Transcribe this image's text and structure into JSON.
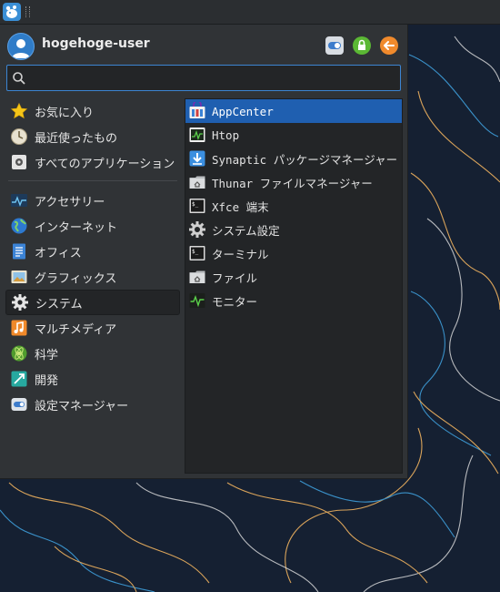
{
  "panel": {
    "menu_button_icon": "xfce-mouse-icon"
  },
  "header": {
    "username": "hogehoge-user",
    "buttons": [
      {
        "icon": "settings-toggle-icon",
        "color": "#5a86c0"
      },
      {
        "icon": "lock-icon",
        "color": "#5bb834"
      },
      {
        "icon": "logout-icon",
        "color": "#f08a2c"
      }
    ]
  },
  "search": {
    "value": "",
    "placeholder": ""
  },
  "categories": [
    {
      "label": "お気に入り",
      "icon": "star-icon"
    },
    {
      "label": "最近使ったもの",
      "icon": "clock-icon"
    },
    {
      "label": "すべてのアプリケーション",
      "icon": "all-apps-icon"
    },
    {
      "label": "アクセサリー",
      "icon": "accessories-icon"
    },
    {
      "label": "インターネット",
      "icon": "globe-icon"
    },
    {
      "label": "オフィス",
      "icon": "office-icon"
    },
    {
      "label": "グラフィックス",
      "icon": "graphics-icon"
    },
    {
      "label": "システム",
      "icon": "gear-icon",
      "selected": true
    },
    {
      "label": "マルチメディア",
      "icon": "music-icon"
    },
    {
      "label": "科学",
      "icon": "science-icon"
    },
    {
      "label": "開発",
      "icon": "development-icon"
    },
    {
      "label": "設定マネージャー",
      "icon": "settings-manager-icon"
    }
  ],
  "apps": [
    {
      "label": "AppCenter",
      "icon": "appcenter-icon",
      "selected": true
    },
    {
      "label": "Htop",
      "icon": "htop-icon"
    },
    {
      "label": "Synaptic パッケージマネージャー",
      "icon": "synaptic-icon"
    },
    {
      "label": "Thunar ファイルマネージャー",
      "icon": "folder-home-icon"
    },
    {
      "label": "Xfce 端末",
      "icon": "terminal-icon"
    },
    {
      "label": "システム設定",
      "icon": "gear-icon"
    },
    {
      "label": "ターミナル",
      "icon": "terminal-icon"
    },
    {
      "label": "ファイル",
      "icon": "folder-home-icon"
    },
    {
      "label": "モニター",
      "icon": "system-monitor-icon"
    }
  ]
}
